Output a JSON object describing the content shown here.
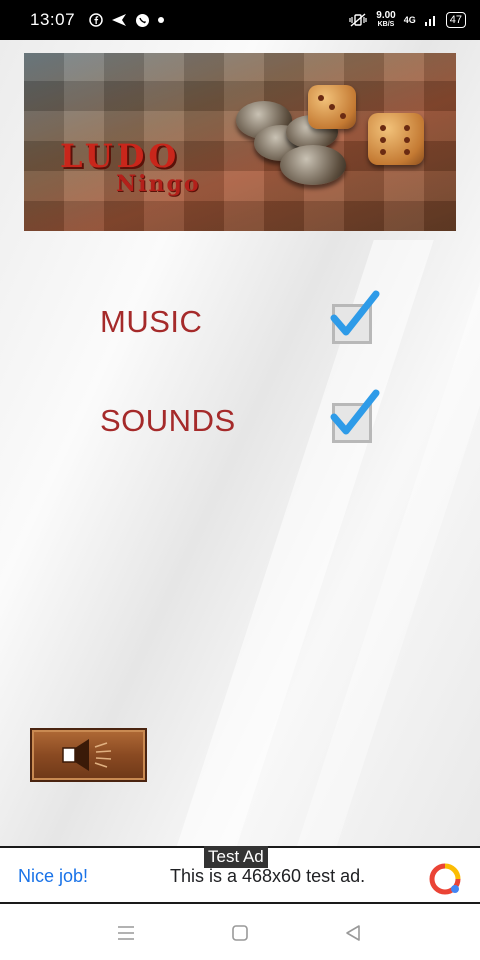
{
  "status_bar": {
    "time": "13:07",
    "net_speed_value": "9.00",
    "net_speed_unit": "KB/S",
    "network": "4G",
    "battery": "47"
  },
  "banner": {
    "logo_line1": "LUDO",
    "logo_line2": "Ningo"
  },
  "settings": {
    "music_label": "MUSIC",
    "music_checked": true,
    "sounds_label": "SOUNDS",
    "sounds_checked": true
  },
  "speaker_button": {
    "icon": "speaker-icon"
  },
  "ad": {
    "tag": "Test Ad",
    "nice_job": "Nice job!",
    "text": "This is a 468x60 test ad."
  },
  "colors": {
    "label_red": "#a52a2a",
    "check_blue": "#2e9be8",
    "button_brown": "#8a4a22"
  }
}
